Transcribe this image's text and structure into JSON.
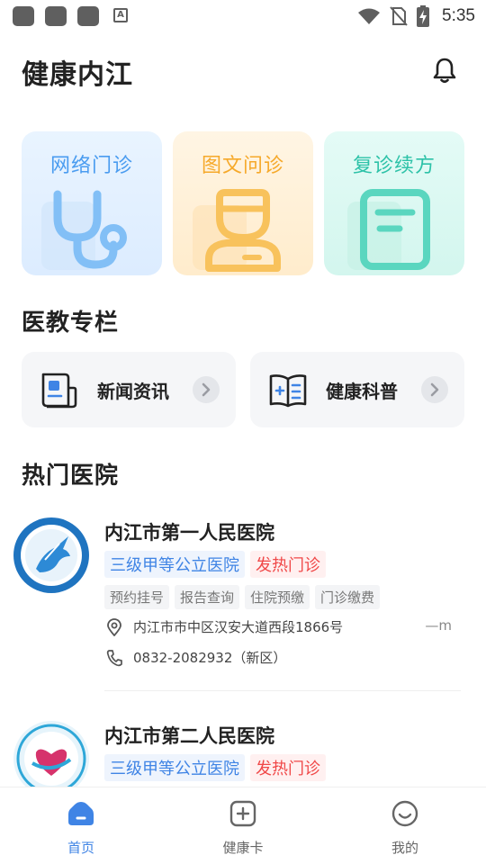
{
  "status_bar": {
    "time": "5:35",
    "a_label": "A"
  },
  "header": {
    "title": "健康内江"
  },
  "services": [
    {
      "label": "网络门诊",
      "icon": "stethoscope-icon"
    },
    {
      "label": "图文问诊",
      "icon": "doctor-icon"
    },
    {
      "label": "复诊续方",
      "icon": "prescription-icon"
    }
  ],
  "edu_section": {
    "title": "医教专栏",
    "items": [
      {
        "label": "新闻资讯",
        "icon": "news-icon"
      },
      {
        "label": "健康科普",
        "icon": "book-icon"
      }
    ]
  },
  "hospital_section": {
    "title": "热门医院",
    "hospitals": [
      {
        "name": "内江市第一人民医院",
        "level": "三级甲等公立医院",
        "fever": "发热门诊",
        "services": [
          "预约挂号",
          "报告查询",
          "住院预缴",
          "门诊缴费"
        ],
        "address": "内江市市中区汉安大道西段1866号",
        "distance": "—m",
        "phone": "0832-2082932（新区）"
      },
      {
        "name": "内江市第二人民医院",
        "level": "三级甲等公立医院",
        "fever": "发热门诊"
      }
    ]
  },
  "bottom_nav": [
    {
      "label": "首页",
      "active": true
    },
    {
      "label": "健康卡",
      "active": false
    },
    {
      "label": "我的",
      "active": false
    }
  ],
  "colors": {
    "primary_blue": "#3f84e5",
    "fever_red": "#f04848",
    "online_blue": "#4a9cf0",
    "graphic_orange": "#f6a92a",
    "refill_teal": "#2dc2a8"
  }
}
